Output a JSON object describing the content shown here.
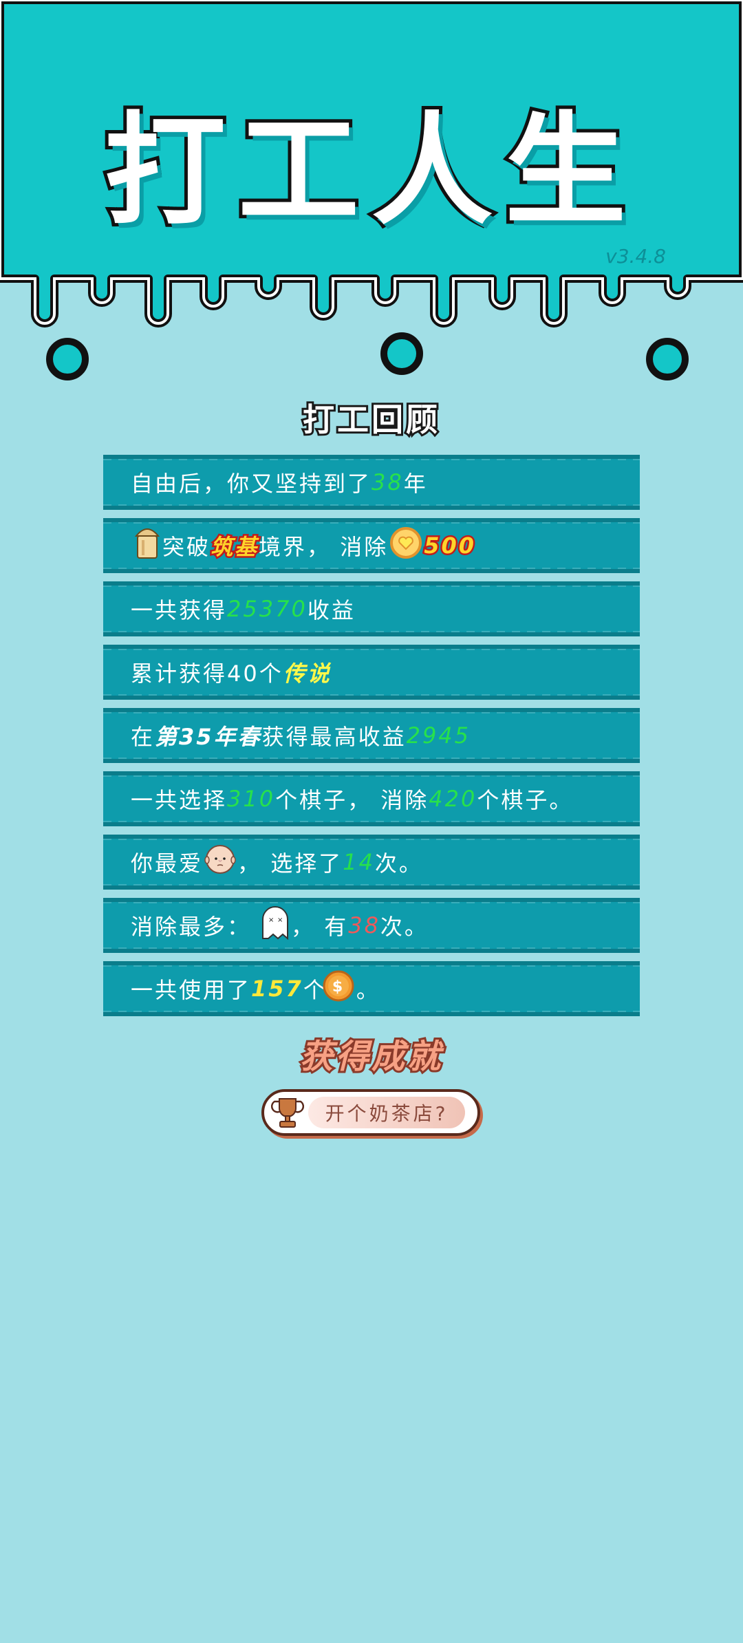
{
  "header": {
    "title": "打工人生",
    "version": "v3.4.8"
  },
  "review": {
    "title": "打工回顾",
    "rows": [
      {
        "p1": "自由后，你又坚持到了",
        "v1": "38",
        "p2": "年"
      },
      {
        "p1": "突破",
        "realm": "筑基",
        "p2": "境界，  消除",
        "v1": "500",
        "icons": [
          "bucket-icon",
          "heart-coin-icon"
        ]
      },
      {
        "p1": "一共获得",
        "v1": "25370",
        "p2": "收益"
      },
      {
        "p1": "累计获得40个",
        "v1": "传说"
      },
      {
        "p1": "在 ",
        "v1": "第35年春",
        "p2": " 获得最高收益",
        "v2": "2945"
      },
      {
        "p1": "一共选择",
        "v1": "310",
        "p2": "个棋子，  消除",
        "v2": "420",
        "p3": "个棋子。"
      },
      {
        "p1": "你最爱",
        "p2": "，  选择了",
        "v1": "14",
        "p3": "次。",
        "icons": [
          "bald-man-face-icon"
        ]
      },
      {
        "p1": "消除最多：",
        "p2": "，  有",
        "v1": "38",
        "p3": "次。",
        "icons": [
          "ghost-icon"
        ]
      },
      {
        "p1": "一共使用了",
        "v1": "157",
        "p2": "个",
        "p3": "。",
        "icons": [
          "dollar-coin-icon"
        ]
      }
    ]
  },
  "achievement": {
    "title": "获得成就",
    "badge_label": "开个奶茶店?"
  },
  "colors": {
    "header_teal": "#14c6c8",
    "background": "#a1dfe6",
    "row_bg": "#0e9cac",
    "highlight_green": "#27e14b",
    "highlight_yellow": "#ffe83a",
    "highlight_red": "#ef5a5a"
  }
}
